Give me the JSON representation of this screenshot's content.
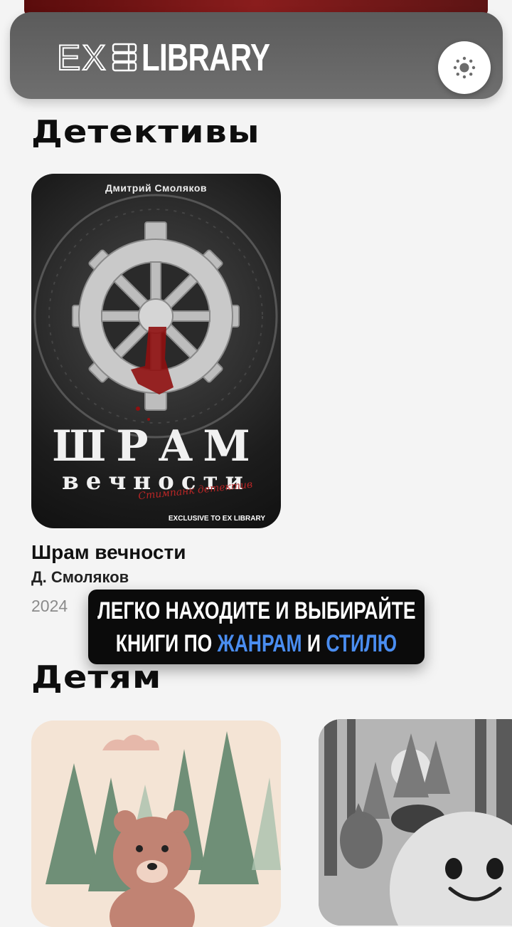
{
  "header": {
    "logo_part1": "EX",
    "logo_part2": "LIBRARY",
    "theme_icon": "sun-icon"
  },
  "sections": [
    {
      "title": "Детективы",
      "books": [
        {
          "title": "Шрам вечности",
          "author": "Д. Смоляков",
          "year": "2024",
          "cover": {
            "author": "Дмитрий Смоляков",
            "title_line1": "ШРАМ",
            "title_line2": "вечности",
            "subtitle": "Стимпанк детектив",
            "exclusive": "EXCLUSIVE TO EX LIBRARY"
          }
        }
      ]
    },
    {
      "title": "Детям",
      "books": [
        {
          "cover_icon": "bear-forest-illustration"
        },
        {
          "cover_icon": "kolobok-forest-illustration"
        }
      ]
    }
  ],
  "tooltip": {
    "line1": "ЛЕГКО НАХОДИТЕ И ВЫБИРАЙТЕ",
    "line2_part1": "КНИГИ ПО ",
    "line2_accent1": "ЖАНРАМ",
    "line2_part2": " И ",
    "line2_accent2": "СТИЛЮ"
  },
  "colors": {
    "accent": "#4a8df0",
    "header_bg": "#666666",
    "page_bg": "#f4f4f4"
  }
}
